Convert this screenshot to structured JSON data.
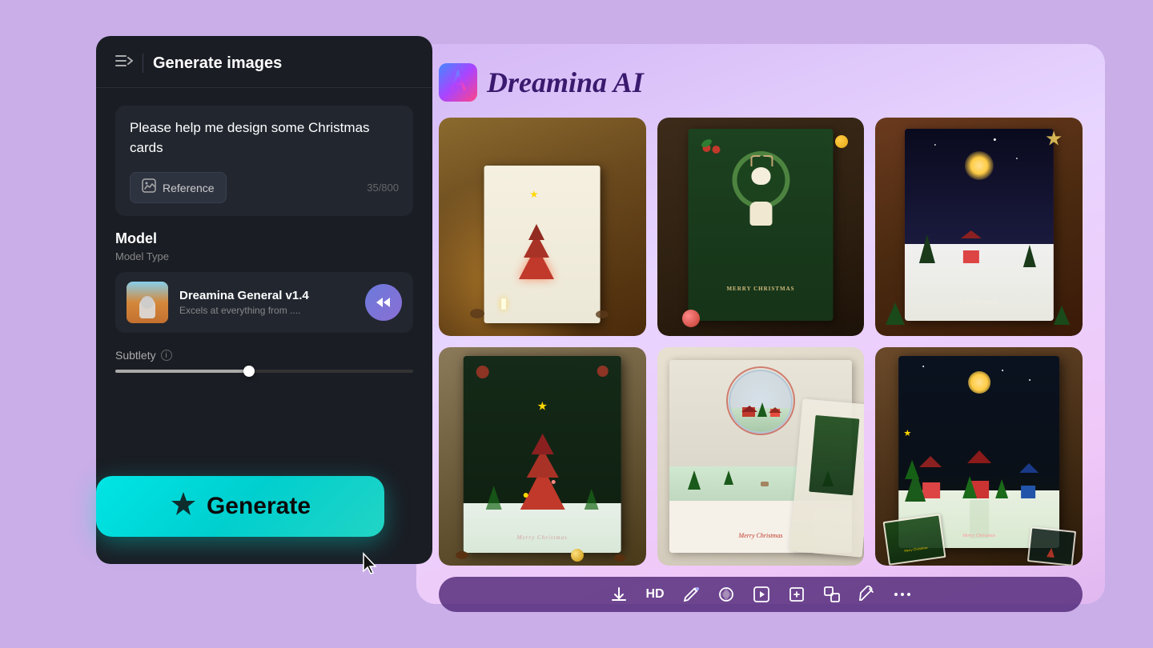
{
  "app": {
    "title": "Dreamina AI",
    "background_color": "#c9aee8"
  },
  "left_panel": {
    "header": {
      "icon": "≡→",
      "title": "Generate images"
    },
    "prompt": {
      "text": "Please help me design some Christmas cards",
      "char_count": "35/800"
    },
    "reference_button": {
      "label": "Reference",
      "icon": "⊞"
    },
    "model_section": {
      "label": "Model",
      "type_label": "Model Type",
      "name": "Dreamina General v1.4",
      "description": "Excels at everything from ...."
    },
    "subtlety": {
      "label": "Subtlety",
      "info": "i"
    },
    "generate_button": {
      "icon": "✦",
      "label": "Generate"
    }
  },
  "right_panel": {
    "logo_icon": "✦",
    "title": "Dreamina AI",
    "images": [
      {
        "id": 1,
        "alt": "Christmas card with red decorated tree",
        "theme": "red-tree"
      },
      {
        "id": 2,
        "alt": "Christmas card with deer and wreath on dark green",
        "theme": "deer"
      },
      {
        "id": 3,
        "alt": "Christmas card dark brown with pine trees and moon",
        "theme": "night-trees"
      },
      {
        "id": 4,
        "alt": "Christmas card with pop-up green tree on dark background",
        "theme": "popup-tree"
      },
      {
        "id": 5,
        "alt": "Christmas card with snow globe and red houses",
        "theme": "snow-globe"
      },
      {
        "id": 6,
        "alt": "Christmas card pop-up 3D village scene",
        "theme": "village"
      }
    ],
    "toolbar": {
      "buttons": [
        {
          "id": "download",
          "icon": "⬇",
          "label": "Download"
        },
        {
          "id": "hd",
          "icon": "HD",
          "label": "HD"
        },
        {
          "id": "edit",
          "icon": "✏",
          "label": "Edit"
        },
        {
          "id": "recolor",
          "icon": "🎨",
          "label": "Recolor"
        },
        {
          "id": "animate",
          "icon": "▶",
          "label": "Animate"
        },
        {
          "id": "expand",
          "icon": "⊡",
          "label": "Expand"
        },
        {
          "id": "resize",
          "icon": "⊞",
          "label": "Resize"
        },
        {
          "id": "erase",
          "icon": "⊘",
          "label": "Erase"
        },
        {
          "id": "more",
          "icon": "···",
          "label": "More"
        }
      ]
    }
  }
}
